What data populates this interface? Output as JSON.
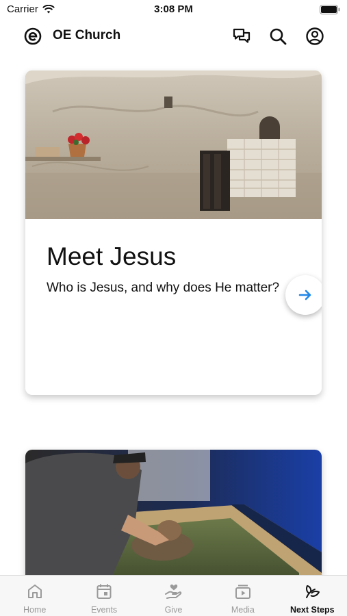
{
  "status_bar": {
    "carrier": "Carrier",
    "time": "3:08 PM"
  },
  "header": {
    "title": "OE Church",
    "icons": [
      "logo-icon",
      "chat-icon",
      "search-icon",
      "account-icon"
    ]
  },
  "cards": [
    {
      "title": "Meet Jesus",
      "subtitle": "Who is Jesus, and why does He matter?",
      "image": "garden-tomb-photo",
      "action_icon": "arrow-right-icon"
    },
    {
      "image": "baptism-photo"
    }
  ],
  "tabs": [
    {
      "label": "Home",
      "icon": "home-icon",
      "active": false
    },
    {
      "label": "Events",
      "icon": "calendar-icon",
      "active": false
    },
    {
      "label": "Give",
      "icon": "give-icon",
      "active": false
    },
    {
      "label": "Media",
      "icon": "media-icon",
      "active": false
    },
    {
      "label": "Next Steps",
      "icon": "leaf-icon",
      "active": true
    }
  ],
  "colors": {
    "accent": "#1f87e8",
    "tab_inactive": "#9a9a9a",
    "tab_active": "#111111"
  }
}
